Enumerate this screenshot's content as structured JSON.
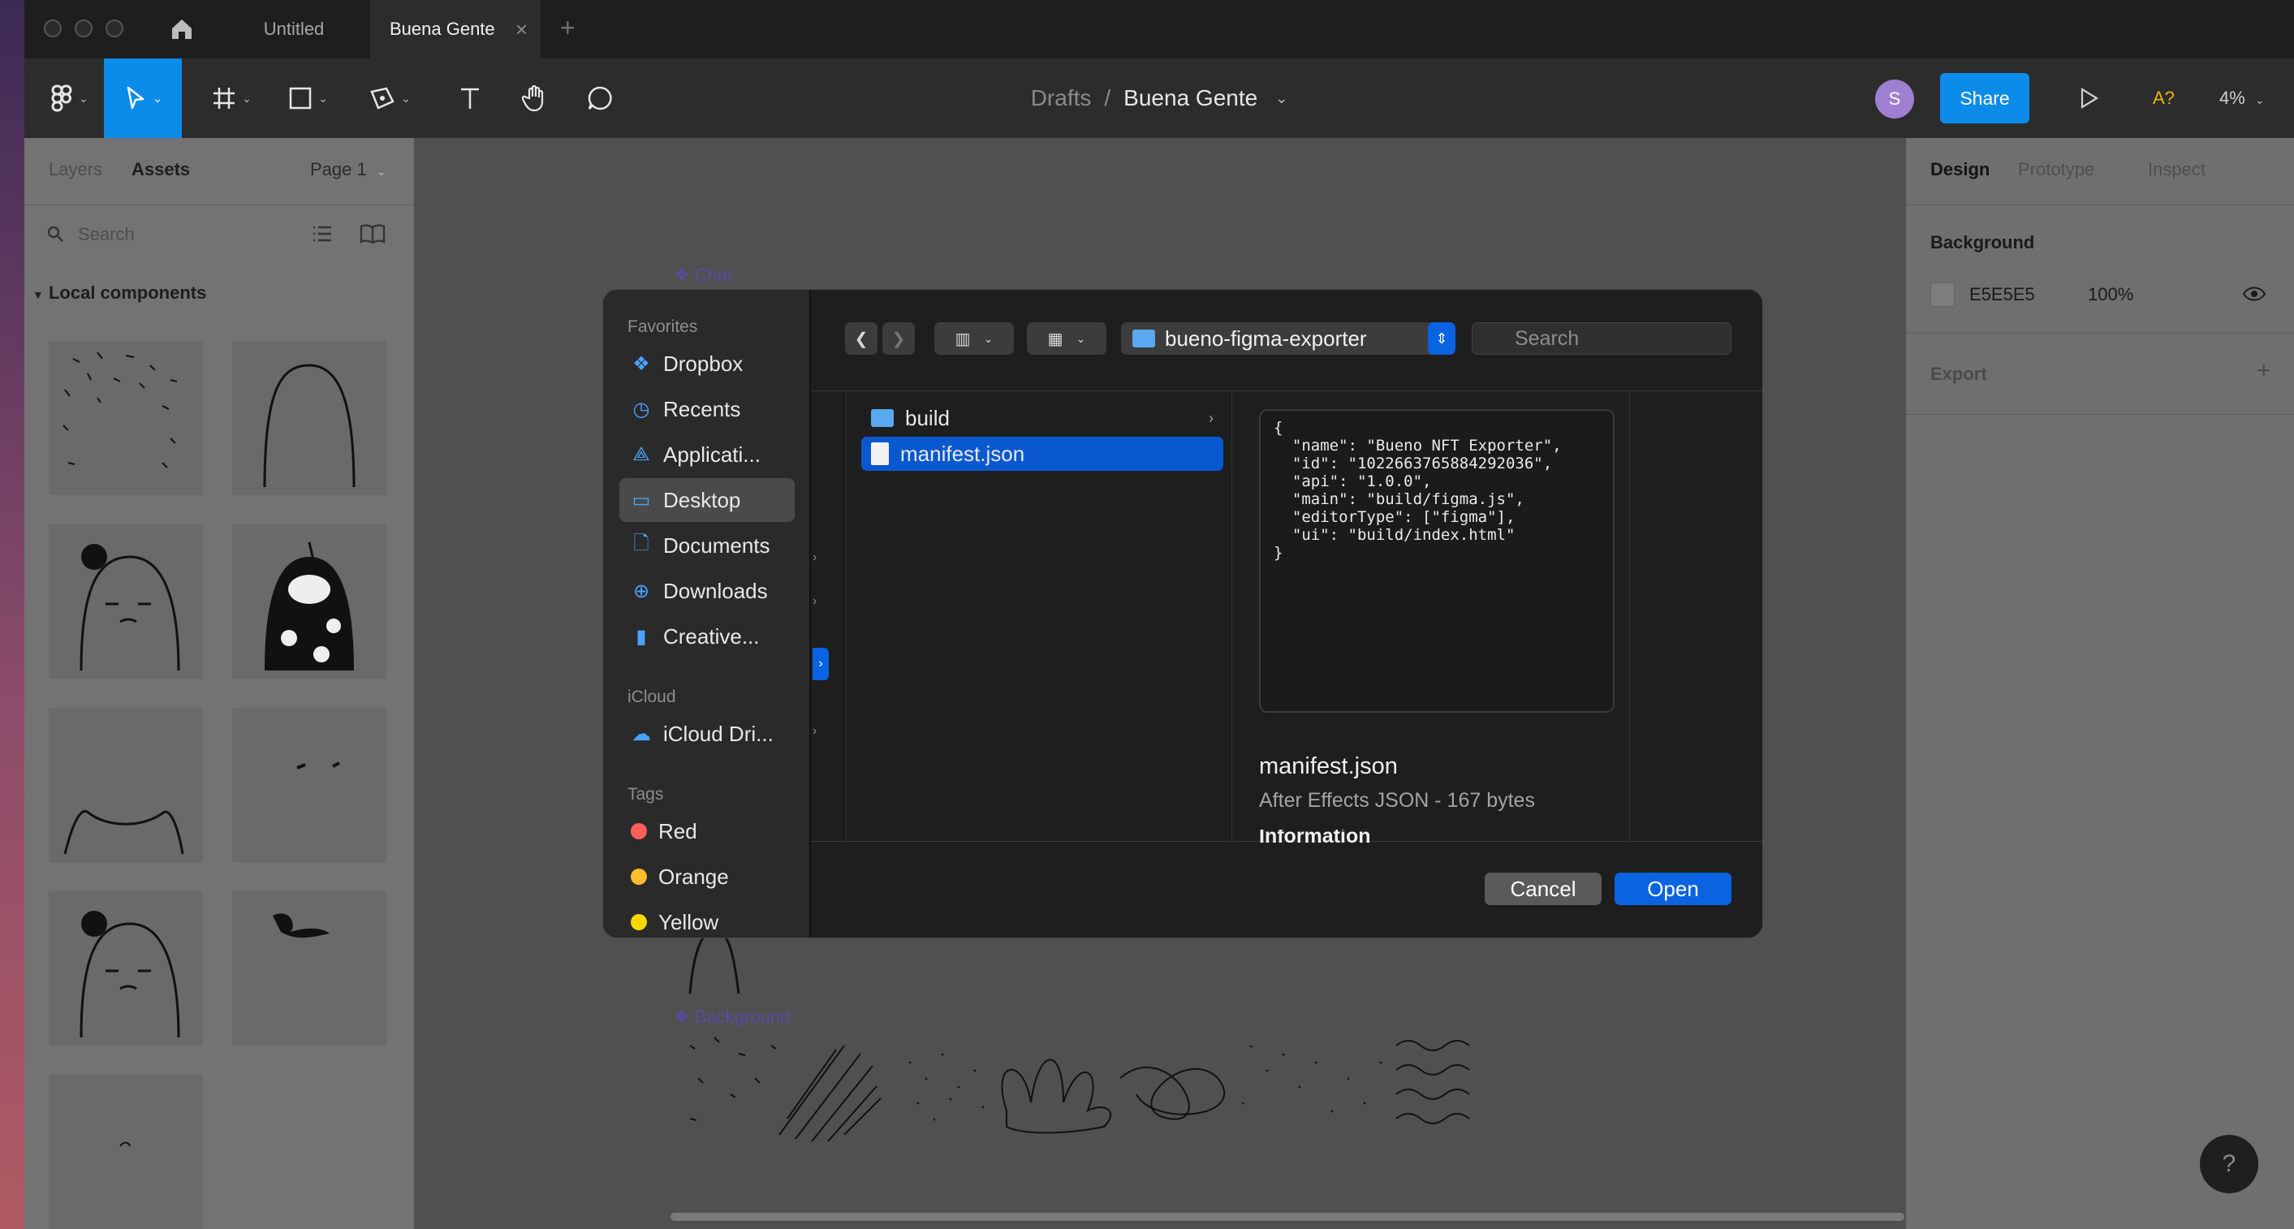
{
  "titlebar": {
    "tabs": [
      {
        "label": "Untitled"
      },
      {
        "label": "Buena Gente"
      }
    ],
    "home_icon": "home-icon",
    "close_tab_icon": "close-icon",
    "new_tab_label": "+"
  },
  "toolbar": {
    "breadcrumb_root": "Drafts",
    "breadcrumb_sep": "/",
    "file_name": "Buena Gente",
    "avatar_initial": "S",
    "share_label": "Share",
    "ai_label": "A?",
    "zoom": "4%"
  },
  "left_panel": {
    "tabs": [
      "Layers",
      "Assets"
    ],
    "active_tab": "Assets",
    "page_label": "Page 1",
    "search_placeholder": "Search",
    "section_title": "Local components"
  },
  "canvas": {
    "frame_label_top": "Char...",
    "frame_label_bottom": "Background"
  },
  "right_panel": {
    "tabs": [
      "Design",
      "Prototype",
      "Inspect"
    ],
    "active_tab": "Design",
    "background_title": "Background",
    "background_hex": "E5E5E5",
    "background_opacity": "100%",
    "export_title": "Export",
    "export_add": "+"
  },
  "dialog": {
    "sidebar": {
      "favorites_title": "Favorites",
      "favorites": [
        {
          "label": "Dropbox",
          "icon": "dropbox-icon"
        },
        {
          "label": "Recents",
          "icon": "clock-icon"
        },
        {
          "label": "Applicati...",
          "icon": "applications-icon"
        },
        {
          "label": "Desktop",
          "icon": "desktop-icon"
        },
        {
          "label": "Documents",
          "icon": "document-icon"
        },
        {
          "label": "Downloads",
          "icon": "download-icon"
        },
        {
          "label": "Creative...",
          "icon": "file-icon"
        }
      ],
      "selected": "Desktop",
      "icloud_title": "iCloud",
      "icloud_item": "iCloud Dri...",
      "tags_title": "Tags",
      "tags": [
        {
          "label": "Red",
          "color": "#ff5f57"
        },
        {
          "label": "Orange",
          "color": "#febc2e"
        },
        {
          "label": "Yellow",
          "color": "#f5d800"
        }
      ]
    },
    "path_label": "bueno-figma-exporter",
    "search_placeholder": "Search",
    "files": [
      {
        "name": "build",
        "kind": "folder"
      },
      {
        "name": "manifest.json",
        "kind": "file"
      }
    ],
    "selected_file": "manifest.json",
    "preview_text": "{\n  \"name\": \"Bueno NFT Exporter\",\n  \"id\": \"1022663765884292036\",\n  \"api\": \"1.0.0\",\n  \"main\": \"build/figma.js\",\n  \"editorType\": [\"figma\"],\n  \"ui\": \"build/index.html\"\n}",
    "preview_name": "manifest.json",
    "preview_kind": "After Effects JSON - 167 bytes",
    "preview_info": "Information",
    "cancel_label": "Cancel",
    "open_label": "Open"
  },
  "help_label": "?"
}
